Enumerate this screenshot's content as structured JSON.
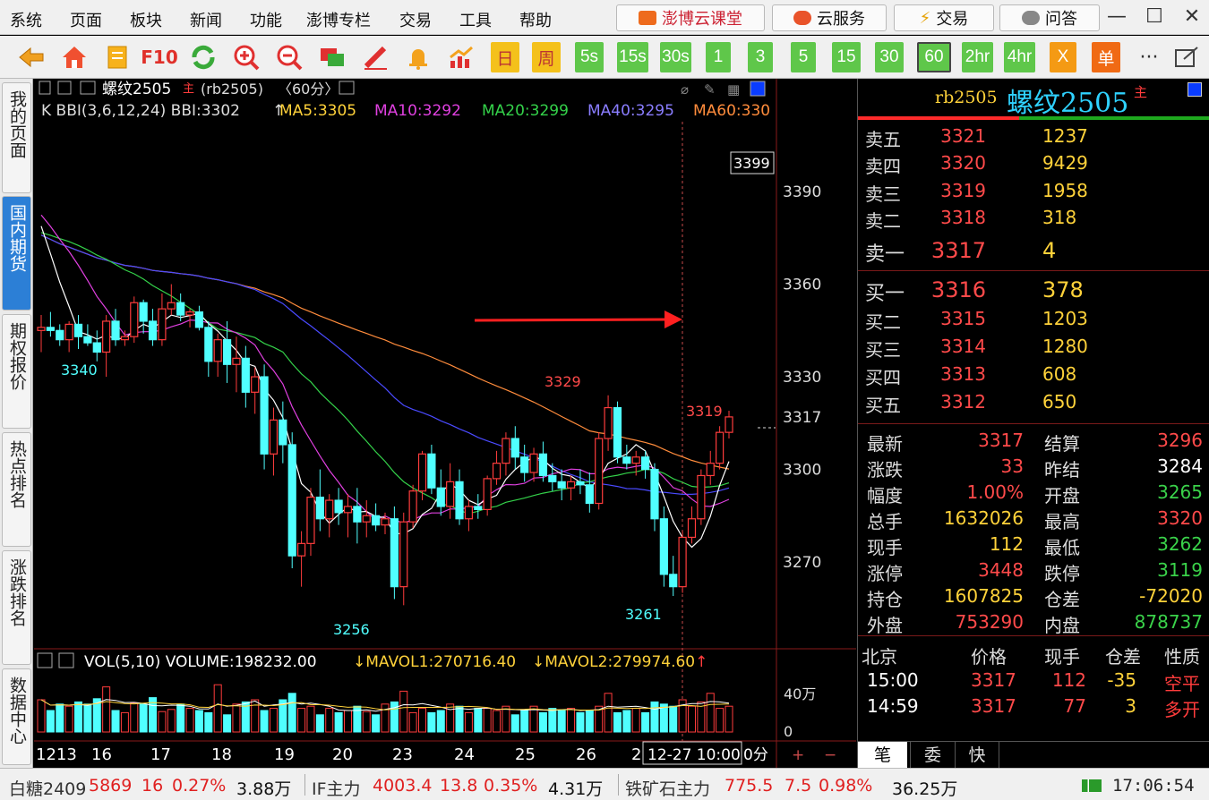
{
  "menu": [
    "系统",
    "页面",
    "板块",
    "新闻",
    "功能",
    "澎博专栏",
    "交易",
    "工具",
    "帮助"
  ],
  "top_buttons": {
    "cloud_class": "澎博云课堂",
    "cloud_service": "云服务",
    "trade": "交易",
    "qa": "问答"
  },
  "toolbar": {
    "f10": "F10",
    "day": "日",
    "week": "周",
    "periods": [
      "5s",
      "15s",
      "30s",
      "1",
      "3",
      "5",
      "15",
      "30",
      "60",
      "2hr",
      "4hr"
    ],
    "selected_period": "60",
    "x_label": "X",
    "single": "单",
    "more": "···"
  },
  "sidebar": [
    "我的页面",
    "国内期货",
    "期权报价",
    "热点排名",
    "涨跌排名",
    "数据中心"
  ],
  "chart": {
    "title": "螺纹2505",
    "title_tag": "主",
    "contract": "(rb2505)",
    "period": "〈60分〉",
    "indicator_line": {
      "bbi": "K BBI(3,6,12,24) BBI:3302",
      "ma5": "MA5:3305",
      "ma10": "MA10:3292",
      "ma20": "MA20:3299",
      "ma40": "MA40:3295",
      "ma60": "MA60:330"
    },
    "price_ticks": [
      "3390",
      "3360",
      "3330",
      "3317",
      "3300",
      "3270"
    ],
    "high_box": "3399",
    "annotations": {
      "low1": "3340",
      "low2": "3256",
      "low3": "3261",
      "high1": "3329",
      "high2": "3319"
    },
    "vol_line": {
      "label": "VOL(5,10) VOLUME:198232.00",
      "mavol1": "MAVOL1:270716.40",
      "mavol2": "MAVOL2:279974.60"
    },
    "vol_ticks": [
      "40万",
      "0"
    ],
    "x_labels": [
      "1213",
      "16",
      "17",
      "18",
      "19",
      "20",
      "23",
      "24",
      "25",
      "26",
      "2"
    ],
    "cursor_time": "12-27 10:00",
    "period_label": "0分",
    "plus": "+",
    "minus": "−",
    "colors": {
      "up": "#ff3c3c",
      "down": "#50ffff",
      "ma5": "#ffffff",
      "ma10": "#e040e0",
      "ma20": "#34d24a",
      "ma40": "#4a4aff",
      "ma60": "#ff8c3c"
    }
  },
  "quote": {
    "code": "rb2505",
    "name": "螺纹2505",
    "tag": "主",
    "asks": [
      {
        "label": "卖五",
        "price": "3321",
        "vol": "1237"
      },
      {
        "label": "卖四",
        "price": "3320",
        "vol": "9429"
      },
      {
        "label": "卖三",
        "price": "3319",
        "vol": "1958"
      },
      {
        "label": "卖二",
        "price": "3318",
        "vol": "318"
      },
      {
        "label": "卖一",
        "price": "3317",
        "vol": "4"
      }
    ],
    "bids": [
      {
        "label": "买一",
        "price": "3316",
        "vol": "378"
      },
      {
        "label": "买二",
        "price": "3315",
        "vol": "1203"
      },
      {
        "label": "买三",
        "price": "3314",
        "vol": "1280"
      },
      {
        "label": "买四",
        "price": "3313",
        "vol": "608"
      },
      {
        "label": "买五",
        "price": "3312",
        "vol": "650"
      }
    ],
    "stats": [
      {
        "l1": "最新",
        "v1": "3317",
        "c1": "#ff4a4a",
        "l2": "结算",
        "v2": "3296",
        "c2": "#ff4a4a"
      },
      {
        "l1": "涨跌",
        "v1": "33",
        "c1": "#ff4a4a",
        "l2": "昨结",
        "v2": "3284",
        "c2": "#ffffff"
      },
      {
        "l1": "幅度",
        "v1": "1.00%",
        "c1": "#ff4a4a",
        "l2": "开盘",
        "v2": "3265",
        "c2": "#3ad24a"
      },
      {
        "l1": "总手",
        "v1": "1632026",
        "c1": "#ffd23a",
        "l2": "最高",
        "v2": "3320",
        "c2": "#ff4a4a"
      },
      {
        "l1": "现手",
        "v1": "112",
        "c1": "#ffd23a",
        "l2": "最低",
        "v2": "3262",
        "c2": "#3ad24a"
      },
      {
        "l1": "涨停",
        "v1": "3448",
        "c1": "#ff4a4a",
        "l2": "跌停",
        "v2": "3119",
        "c2": "#3ad24a"
      },
      {
        "l1": "持仓",
        "v1": "1607825",
        "c1": "#ffd23a",
        "l2": "仓差",
        "v2": "-72020",
        "c2": "#ffd23a"
      },
      {
        "l1": "外盘",
        "v1": "753290",
        "c1": "#ff4a4a",
        "l2": "内盘",
        "v2": "878737",
        "c2": "#3ad24a"
      }
    ],
    "ticks_header": [
      "北京",
      "价格",
      "现手",
      "仓差",
      "性质"
    ],
    "ticks": [
      {
        "time": "15:00",
        "price": "3317",
        "vol": "112",
        "oi": "-35",
        "nature": "空平"
      },
      {
        "time": "14:59",
        "price": "3317",
        "vol": "77",
        "oi": "3",
        "nature": "多开"
      }
    ],
    "tabs": [
      "笔",
      "委",
      "快"
    ]
  },
  "statusbar": {
    "items": [
      {
        "name": "白糖2409",
        "price": "5869",
        "chg": "16",
        "pct": "0.27%",
        "vol": "3.88万"
      },
      {
        "name": "IF主力",
        "price": "4003.4",
        "chg": "13.8",
        "pct": "0.35%",
        "vol": "4.31万"
      },
      {
        "name": "铁矿石主力",
        "price": "775.5",
        "chg": "7.5",
        "pct": "0.98%",
        "vol": "36.25万"
      }
    ],
    "clock": "17:06:54"
  }
}
